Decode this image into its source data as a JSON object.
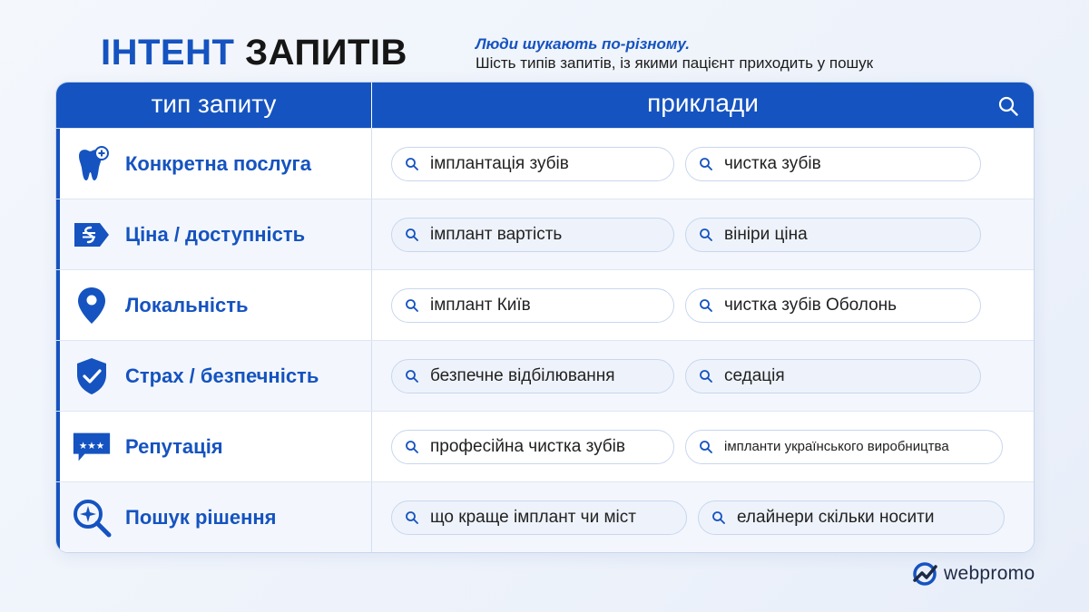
{
  "header": {
    "title_accent": "ІНТЕНТ",
    "title_rest": "ЗАПИТІВ",
    "subtitle_line1": "Люди шукають по-різному.",
    "subtitle_line2": "Шість типів запитів, із якими пацієнт приходить у пошук"
  },
  "table": {
    "col1_header": "тип запиту",
    "col2_header": "приклади",
    "rows": [
      {
        "icon": "tooth-plus-icon",
        "label": "Конкретна послуга",
        "examples": [
          "імплантація зубів",
          "чистка зубів"
        ]
      },
      {
        "icon": "price-tag-hryvnia-icon",
        "label": "Ціна / доступність",
        "examples": [
          "імплант вартість",
          "вініри ціна"
        ]
      },
      {
        "icon": "location-pin-icon",
        "label": "Локальність",
        "examples": [
          "імплант Київ",
          "чистка зубів Оболонь"
        ]
      },
      {
        "icon": "shield-check-icon",
        "label": "Страх / безпечність",
        "examples": [
          "безпечне відбілювання",
          "седація"
        ]
      },
      {
        "icon": "rating-stars-bubble-icon",
        "label": "Репутація",
        "examples": [
          "професійна чистка зубів",
          "імпланти українського виробництва"
        ]
      },
      {
        "icon": "magnifier-sparkle-icon",
        "label": "Пошук рішення",
        "examples": [
          "що краще імплант чи міст",
          "елайнери скільки носити"
        ]
      }
    ]
  },
  "brand": {
    "logo_text": "webpromo",
    "accent_color": "#1553c0"
  }
}
